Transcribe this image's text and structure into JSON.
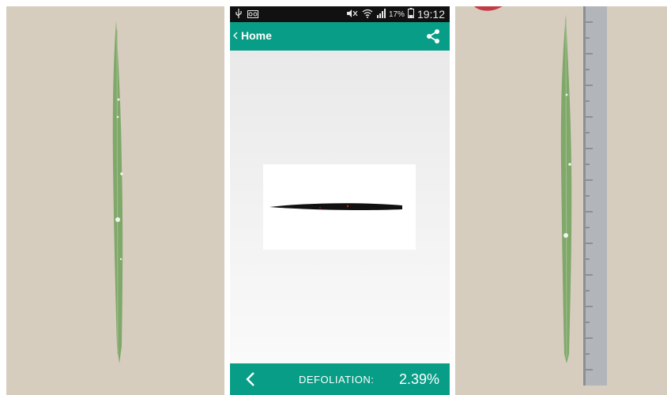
{
  "status_bar": {
    "usb_icon": "usb-icon",
    "voicemail_icon": "voicemail-icon",
    "battery_percent": "17%",
    "time": "19:12"
  },
  "app_bar": {
    "back_label": "Home",
    "share_icon": "share-icon"
  },
  "footer": {
    "label": "DEFOLIATION:",
    "value": "2.39%",
    "back_icon": "chevron-left-icon"
  },
  "colors": {
    "accent": "#079d86",
    "status_bar": "#111111"
  }
}
